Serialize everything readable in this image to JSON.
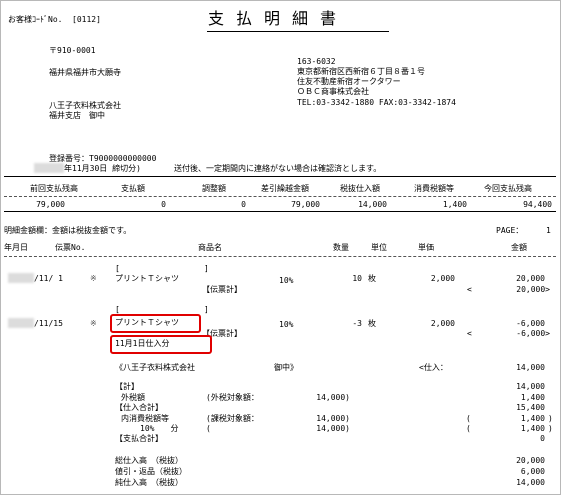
{
  "title": "支払明細書",
  "customer_code_label": "お客様ｺｰﾄﾞNo.",
  "customer_code": "[0112]",
  "recipient": {
    "postal": "〒910-0001",
    "address": "福井県福井市大願寺",
    "company": "八王子衣料株式会社",
    "branch": "福井支店　御中"
  },
  "sender": {
    "postal": "163-6032",
    "address1": "東京都新宿区西新宿６丁目８番１号",
    "address2": "住友不動産新宿オークタワー",
    "company": "ＯＢＣ商事株式会社",
    "tel_fax": "TEL:03-3342-1880 FAX:03-3342-1874"
  },
  "registration": "登録番号：T9000000000000",
  "closing_date": "年11月30日 締切分)",
  "closing_note": "送付後、一定期間内に連絡がない場合は確認済とします。",
  "summary": {
    "headers": [
      "前回支払残高",
      "支払額",
      "調整額",
      "差引繰越金額",
      "税抜仕入額",
      "消費税額等",
      "今回支払残高"
    ],
    "values": [
      "79,000",
      "0",
      "0",
      "79,000",
      "14,000",
      "1,400",
      "94,400"
    ]
  },
  "detail_note": "明細金額欄：金額は税抜金額です。",
  "page_label": "PAGE：",
  "page_number": "1",
  "columns": {
    "date": "年月日",
    "slip": "伝票No.",
    "product": "商品名",
    "qty": "数量",
    "unit": "単位",
    "price": "単価",
    "amount": "金額"
  },
  "rows": [
    {
      "bracket_open": "[",
      "bracket_close": "]",
      "date": "/11/ 1",
      "mark": "※",
      "product": "プリントＴシャツ",
      "tax_rate": "10%",
      "qty": "10",
      "unit": "枚",
      "price": "2,000",
      "amount": "20,000",
      "slip_total_label": "【伝票計】",
      "slip_total": "20,000>",
      "slip_total_open": "<"
    },
    {
      "bracket_open": "[",
      "bracket_close": "]",
      "date": "/11/15",
      "mark": "※",
      "product": "プリントＴシャツ",
      "tax_rate": "10%",
      "qty": "-3",
      "unit": "枚",
      "price": "2,000",
      "amount": "-6,000",
      "slip_total_label": "【伝票計】",
      "slip_total": "-6,000>",
      "slip_total_open": "<",
      "note": "11月1日仕入分"
    }
  ],
  "footer": {
    "party": "《八王子衣料株式会社",
    "honorific": "御中》",
    "purchase_label": "<仕入：",
    "purchase_value": "14,000",
    "total_label": "【計】",
    "total_value": "14,000",
    "ext_tax_label": "外税額",
    "ext_tax_basis_label": "(外税対象額：",
    "ext_tax_basis_value": "14,000)",
    "ext_tax_value": "1,400",
    "purchase_total_label": "【仕入合計】",
    "purchase_total_value": "15,400",
    "int_tax_label": "内消費税額等",
    "int_tax_basis_label": "(課税対象額：",
    "int_tax_basis_value": "14,000)",
    "int_tax_value": "1,400",
    "rate_label": "10%　　分",
    "rate_paren": "(",
    "rate_basis_value": "14,000)",
    "rate_value": "1,400",
    "paren_open": "(",
    "paren_close": ")",
    "payment_total_label": "【支払合計】",
    "payment_total_value": "0",
    "totals": [
      {
        "label": "総仕入高　（税抜）",
        "value": "20,000"
      },
      {
        "label": "値引・返品（税抜）",
        "value": "6,000"
      },
      {
        "label": "純仕入高　（税抜）",
        "value": "14,000"
      }
    ]
  }
}
